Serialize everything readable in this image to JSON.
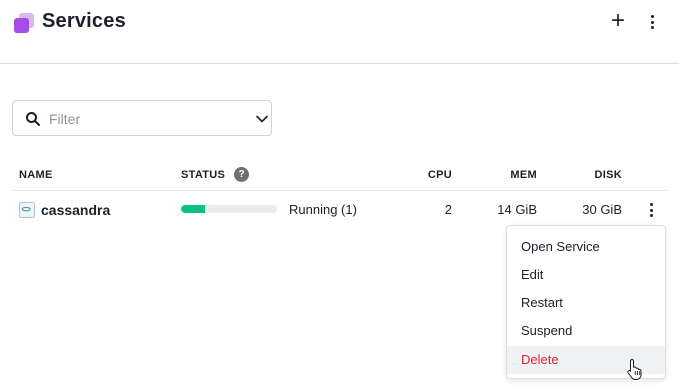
{
  "header": {
    "title": "Services",
    "add_label": "+",
    "icons": {
      "app": "services-icon",
      "add": "plus-icon",
      "more": "more-vertical-icon"
    }
  },
  "filter": {
    "placeholder": "Filter",
    "value": "",
    "icons": {
      "search": "search-icon",
      "dropdown": "chevron-down-icon"
    }
  },
  "table": {
    "columns": {
      "name": "NAME",
      "status": "STATUS",
      "status_help": "?",
      "cpu": "CPU",
      "mem": "MEM",
      "disk": "DISK"
    },
    "rows": [
      {
        "name": "cassandra",
        "icon": "service-icon",
        "status_text": "Running (1)",
        "progress_fraction": 0.25,
        "progress_color": "#0ac27a",
        "cpu": "2",
        "mem": "14 GiB",
        "disk": "30 GiB"
      }
    ]
  },
  "context_menu": {
    "items": [
      {
        "label": "Open Service"
      },
      {
        "label": "Edit"
      },
      {
        "label": "Restart"
      },
      {
        "label": "Suspend"
      },
      {
        "label": "Delete",
        "danger": true,
        "danger_color": "#e0242e"
      }
    ]
  },
  "colors": {
    "brand_purple": "#a54de6",
    "running_green": "#0ac27a",
    "danger_red": "#e0242e"
  }
}
